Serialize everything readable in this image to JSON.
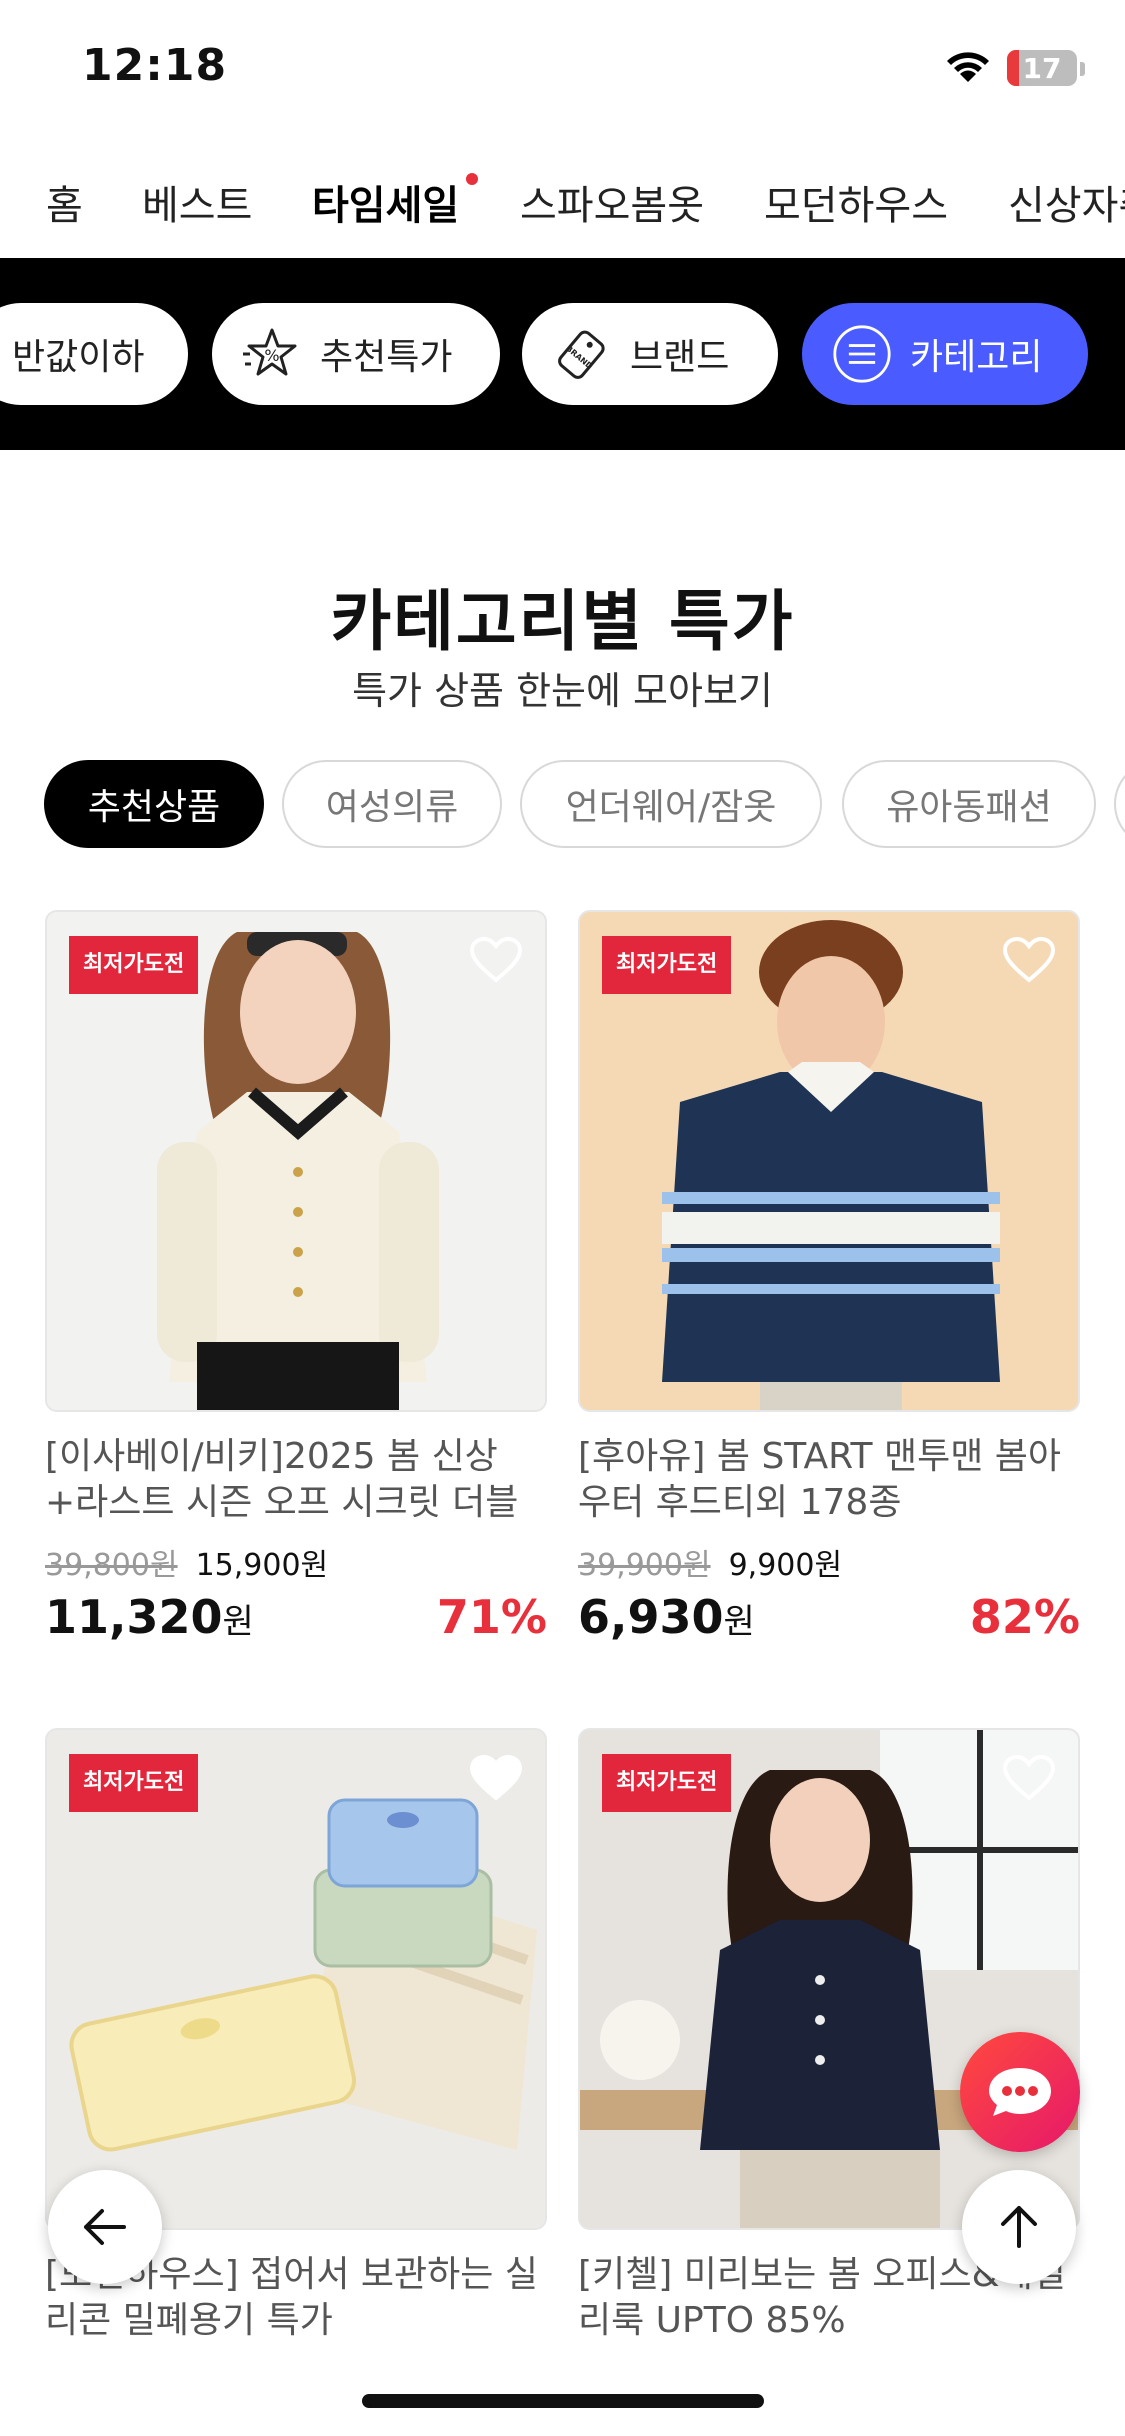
{
  "status_bar": {
    "time": "12:18",
    "battery": "17",
    "battery_level": 0.17
  },
  "top_nav": {
    "items": [
      "홈",
      "베스트",
      "타임세일",
      "스파오봄옷",
      "모던하우스",
      "신상자취"
    ],
    "active_index": 2
  },
  "quick_bar": {
    "items": [
      {
        "label": "반값이하",
        "icon": ""
      },
      {
        "label": "추천특가",
        "icon": "star-percent-icon"
      },
      {
        "label": "브랜드",
        "icon": "brand-tag-icon"
      },
      {
        "label": "카테고리",
        "icon": "menu-icon"
      }
    ],
    "active_color": "#4a5cff"
  },
  "section": {
    "title": "카테고리별 특가",
    "subtitle": "특가 상품 한눈에 모아보기"
  },
  "chips": [
    "추천상품",
    "여성의류",
    "언더웨어/잠옷",
    "유아동패션"
  ],
  "products": [
    {
      "badge": "최저가도전",
      "title": "[이사베이/비키]2025 봄 신상+라스트 시즌 오프 시크릿 더블 …",
      "price_original": "39,800원",
      "price_coupon": "15,900원",
      "price_final": "11,320",
      "unit": "원",
      "discount": "71%"
    },
    {
      "badge": "최저가도전",
      "title": "[후아유] 봄 START 맨투맨 봄아우터 후드티외 178종",
      "price_original": "39,900원",
      "price_coupon": "9,900원",
      "price_final": "6,930",
      "unit": "원",
      "discount": "82%"
    },
    {
      "badge": "최저가도전",
      "title": "[모던하우스] 접어서 보관하는 실리콘 밀폐용기 특가"
    },
    {
      "badge": "최저가도전",
      "title": "[키첼] 미리보는 봄 오피스&데일리룩 UPTO 85%"
    }
  ],
  "colors": {
    "accent_red": "#e8303d",
    "badge_red": "#e2263b",
    "accent_blue": "#4a5cff"
  }
}
